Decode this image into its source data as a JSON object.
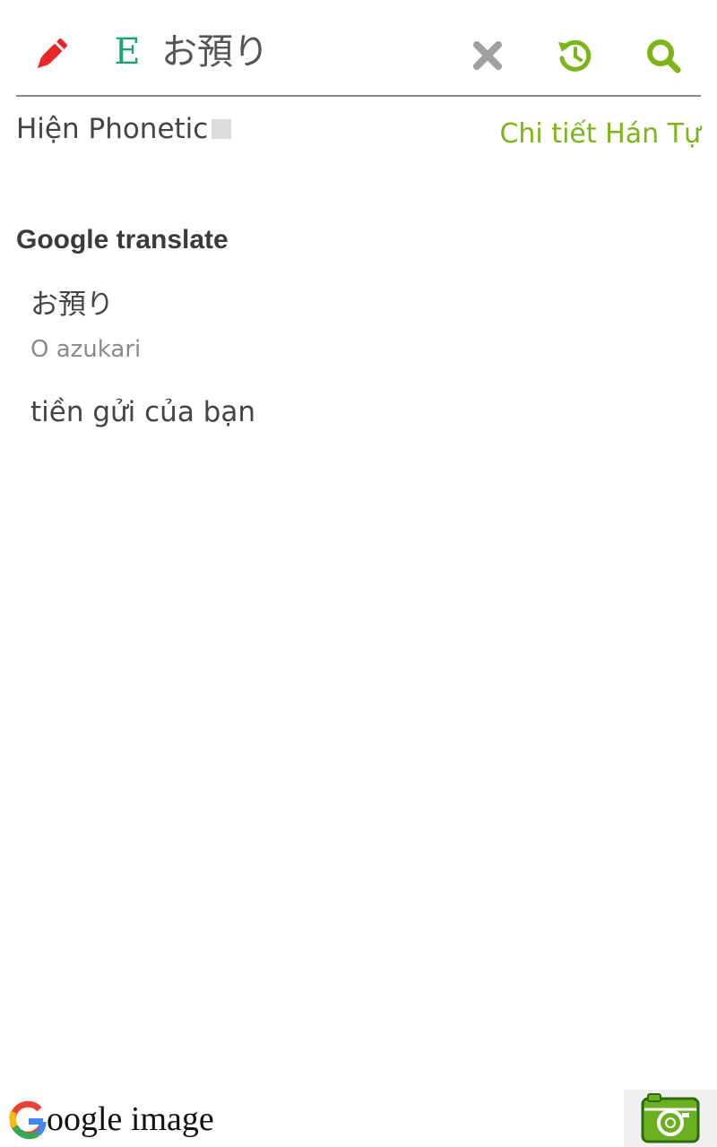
{
  "search": {
    "lang_badge": "E",
    "query": "お預り",
    "icons": {
      "edit": "pencil-icon",
      "clear": "close-icon",
      "history": "history-icon",
      "search": "search-icon"
    }
  },
  "phonetic": {
    "label": "Hiện Phonetic",
    "checked": false
  },
  "detail_link": "Chi tiết Hán Tự",
  "google_translate": {
    "title": "Google translate",
    "source": "お預り",
    "romaji": "O azukari",
    "meaning": "tiền gửi của bạn"
  },
  "footer": {
    "google_image_text": "oogle image",
    "google_image_text_full": "Google image",
    "camera_icon": "camera-icon"
  },
  "colors": {
    "accent_green": "#7cb518",
    "pencil_red": "#e8262a",
    "lang_green": "#1aa37a",
    "clear_gray": "#a0a0a0"
  }
}
